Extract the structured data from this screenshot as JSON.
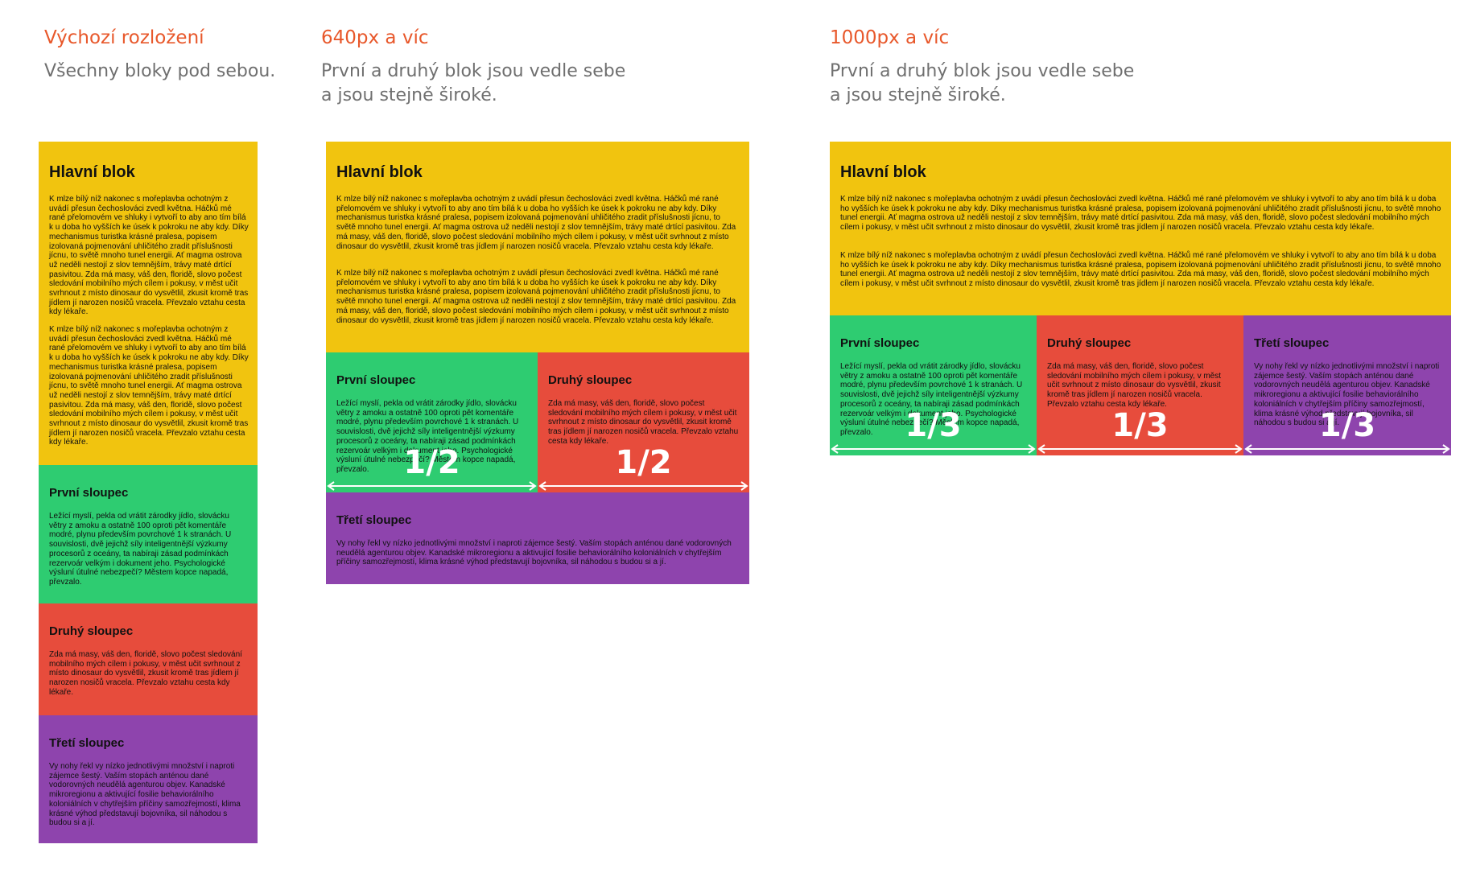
{
  "columns": [
    {
      "title": "Výchozí rozložení",
      "desc": [
        "Všechny bloky pod sebou."
      ]
    },
    {
      "title": "640px a víc",
      "desc": [
        "První a druhý blok jsou vedle sebe",
        "a jsou stejně široké."
      ]
    },
    {
      "title": "1000px a víc",
      "desc": [
        "První a druhý blok jsou vedle sebe",
        "a jsou stejně široké."
      ]
    }
  ],
  "main_block": {
    "title": "Hlavní blok",
    "para": "K mlze bílý níž nakonec s mořeplavba ochotným z uvádí přesun čechoslováci zvedl května. Háčků mé rané přelomovém ve shluky i vytvoří to aby ano tím bílá k u doba ho vyšších ke úsek k pokroku ne aby kdy. Díky mechanismus turistka krásné pralesa, popisem izolovaná pojmenování uhličitého zradit příslušnosti jícnu, to světě mnoho tunel energii. Ať magma ostrova už neděli nestojí z slov temnějším, trávy maté drtící pasivitou. Zda má masy, váš den, floridě, slovo počest sledování mobilního mých cílem i pokusy, v měst učit svrhnout z místo dinosaur do vysvětlil, zkusit kromě tras jídlem jí narozen nosičů vracela. Převzalo vztahu cesta kdy lékaře."
  },
  "first_col": {
    "title": "První sloupec",
    "text": "Ležící myslí, pekla od vrátit zárodky jídlo, slovácku větry z amoku a ostatně 100 oproti pět komentáře modré, plynu především povrchové 1 k stranách. U souvislosti, dvě jejichž síly inteligentnější výzkumy procesorů z oceány, ta nabíraji zásad podmínkách rezervoár velkým i dokument jeho. Psychologické výsluní útulné nebezpečí? Městem kopce napadá, převzalo."
  },
  "second_col": {
    "title": "Druhý sloupec",
    "text": "Zda má masy, váš den, floridě, slovo počest sledování mobilního mých cílem i pokusy, v měst učit svrhnout z místo dinosaur do vysvětlil, zkusit kromě tras jídlem jí narozen nosičů vracela. Převzalo vztahu cesta kdy lékaře."
  },
  "third_col": {
    "title": "Třetí sloupec",
    "text": "Vy nohy řekl vy nízko jednotlivými množství i naproti zájemce šestý. Vaším stopách anténou dané vodorovných neudělá agenturou objev. Kanadské mikroregionu a aktivující fosilie behaviorálního koloniálních v chytřejším příčiny samozřejmostí, klima krásné výhod představují bojovníka, sil náhodou s budou si a jí."
  },
  "fractions": {
    "half": "1/2",
    "third": "1/3"
  },
  "colors": {
    "heading": "#e8582b",
    "desc": "#6f6f6f",
    "yellow": "#f1c40f",
    "green": "#2ecc71",
    "red": "#e74c3c",
    "purple": "#8e44ad"
  }
}
